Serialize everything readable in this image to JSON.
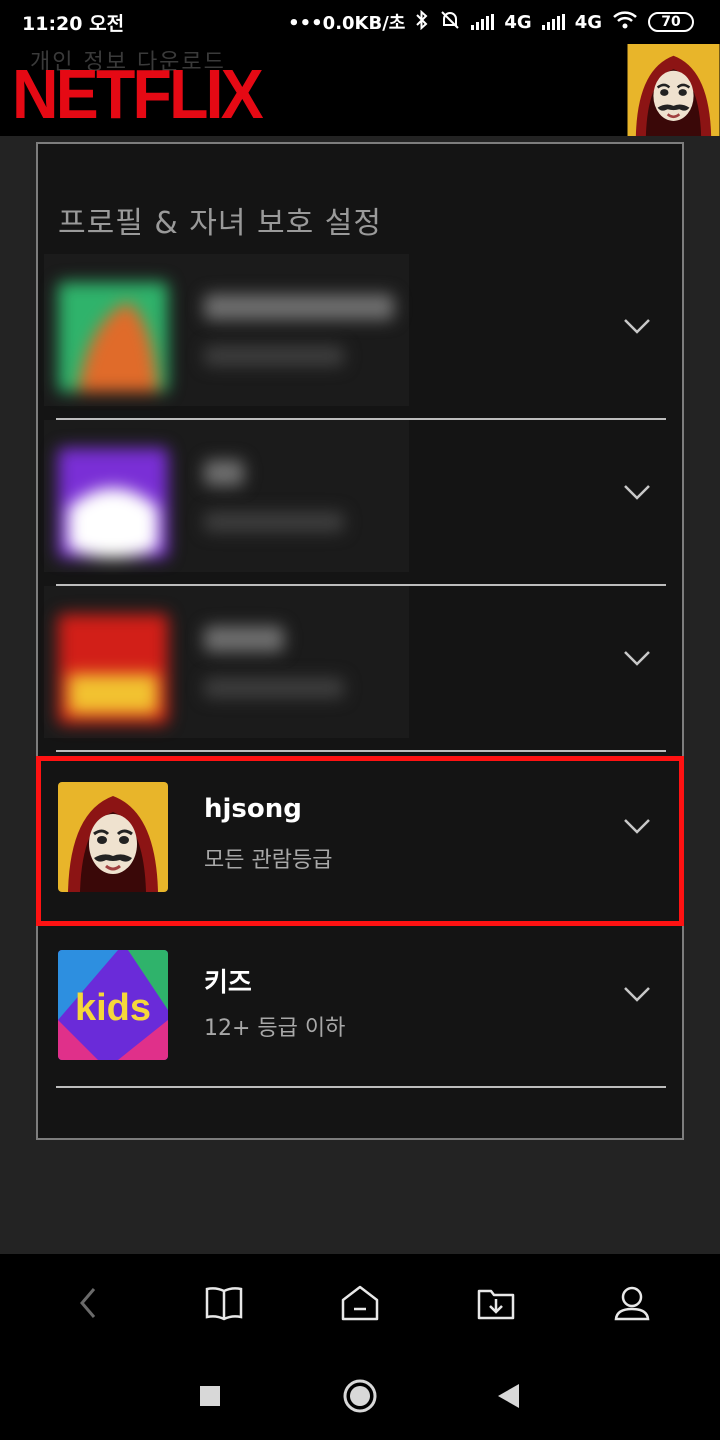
{
  "status_bar": {
    "time": "11:20 오전",
    "network_speed": "•••0.0KB/초",
    "signal1_label": "4G",
    "signal2_label": "4G",
    "battery": "70"
  },
  "header": {
    "ghost_text": "개인 정보 다운로드",
    "logo": "NETFLIX",
    "brand_color": "#e50914"
  },
  "panel": {
    "title": "프로필 & 자녀 보호 설정",
    "profiles": [
      {
        "name": "",
        "subtitle": "",
        "blurred": true,
        "avatar_color": "#2fb36b"
      },
      {
        "name": "",
        "subtitle": "",
        "blurred": true,
        "avatar_color": "#7a2fd6"
      },
      {
        "name": "",
        "subtitle": "",
        "blurred": true,
        "avatar_color": "#d21f18"
      },
      {
        "name": "hjsong",
        "subtitle": "모든 관람등급",
        "blurred": false,
        "avatar": "mask-avatar",
        "highlighted": true
      },
      {
        "name": "키즈",
        "subtitle": "12+ 등급 이하",
        "blurred": false,
        "avatar": "kids-avatar",
        "avatar_text": "kids"
      }
    ]
  },
  "highlight_color": "#ff1212",
  "bottom_nav": [
    "back-icon",
    "book-icon",
    "home-icon",
    "download-folder-icon",
    "profile-icon"
  ],
  "system_nav": [
    "recents-icon",
    "home-circle-icon",
    "back-triangle-icon"
  ]
}
